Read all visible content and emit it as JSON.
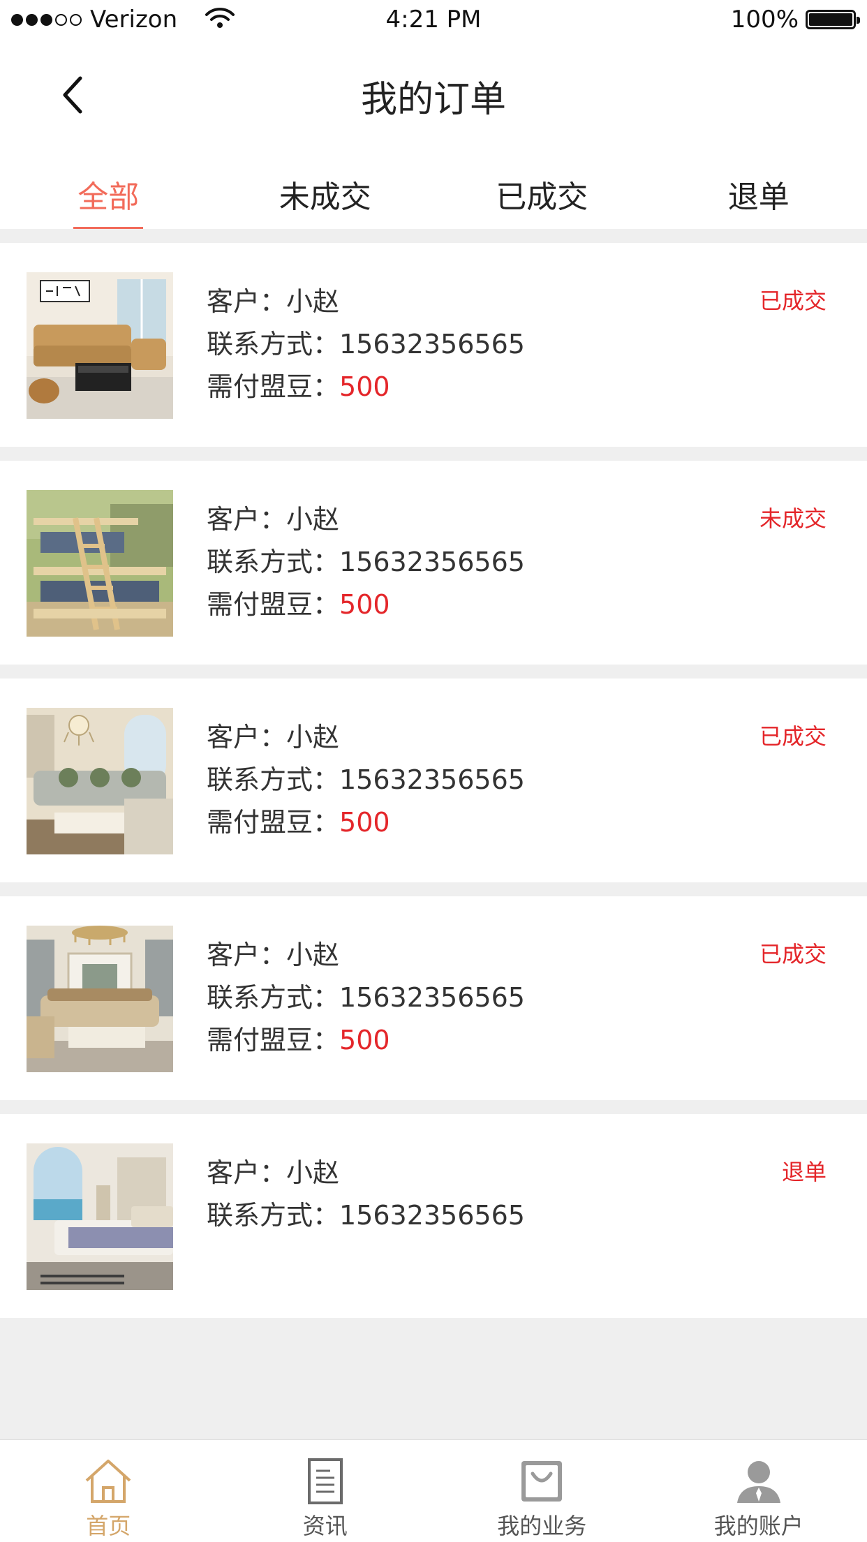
{
  "status_bar": {
    "carrier": "Verizon",
    "time": "4:21 PM",
    "battery": "100%"
  },
  "header": {
    "title": "我的订单"
  },
  "tabs": [
    {
      "label": "全部",
      "active": true
    },
    {
      "label": "未成交",
      "active": false
    },
    {
      "label": "已成交",
      "active": false
    },
    {
      "label": "退单",
      "active": false
    }
  ],
  "orders": [
    {
      "customer": "客户：小赵",
      "contact": "联系方式：15632356565",
      "price_label": "需付盟豆：",
      "price_value": "500",
      "status": "已成交",
      "image": "leather-sofa-living-room"
    },
    {
      "customer": "客户：小赵",
      "contact": "联系方式：15632356565",
      "price_label": "需付盟豆：",
      "price_value": "500",
      "status": "未成交",
      "image": "wooden-bunk-bed"
    },
    {
      "customer": "客户：小赵",
      "contact": "联系方式：15632356565",
      "price_label": "需付盟豆：",
      "price_value": "500",
      "status": "已成交",
      "image": "fabric-sofa-chandelier"
    },
    {
      "customer": "客户：小赵",
      "contact": "联系方式：15632356565",
      "price_label": "需付盟豆：",
      "price_value": "500",
      "status": "已成交",
      "image": "european-sofa-set"
    },
    {
      "customer": "客户：小赵",
      "contact": "联系方式：15632356565",
      "status": "退单",
      "image": "bedroom-seaside-bed"
    }
  ],
  "tab_bar": [
    {
      "label": "首页",
      "icon": "home-icon",
      "active": true
    },
    {
      "label": "资讯",
      "icon": "news-icon",
      "active": false
    },
    {
      "label": "我的业务",
      "icon": "business-bag-icon",
      "active": false
    },
    {
      "label": "我的账户",
      "icon": "account-icon",
      "active": false
    }
  ],
  "colors": {
    "accent": "#f26b5a",
    "price": "#e4262a",
    "tab_bar_active": "#d4a66a",
    "background": "#efefef"
  }
}
